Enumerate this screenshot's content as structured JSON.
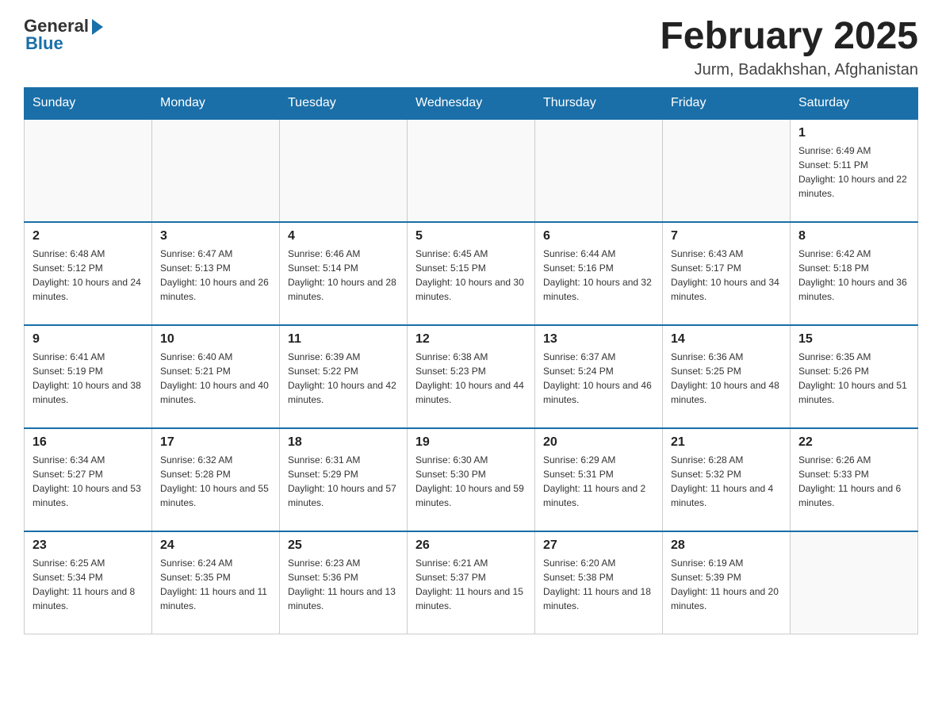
{
  "logo": {
    "general": "General",
    "blue": "Blue"
  },
  "title": "February 2025",
  "location": "Jurm, Badakhshan, Afghanistan",
  "weekdays": [
    "Sunday",
    "Monday",
    "Tuesday",
    "Wednesday",
    "Thursday",
    "Friday",
    "Saturday"
  ],
  "weeks": [
    [
      {
        "day": "",
        "sunrise": "",
        "sunset": "",
        "daylight": ""
      },
      {
        "day": "",
        "sunrise": "",
        "sunset": "",
        "daylight": ""
      },
      {
        "day": "",
        "sunrise": "",
        "sunset": "",
        "daylight": ""
      },
      {
        "day": "",
        "sunrise": "",
        "sunset": "",
        "daylight": ""
      },
      {
        "day": "",
        "sunrise": "",
        "sunset": "",
        "daylight": ""
      },
      {
        "day": "",
        "sunrise": "",
        "sunset": "",
        "daylight": ""
      },
      {
        "day": "1",
        "sunrise": "Sunrise: 6:49 AM",
        "sunset": "Sunset: 5:11 PM",
        "daylight": "Daylight: 10 hours and 22 minutes."
      }
    ],
    [
      {
        "day": "2",
        "sunrise": "Sunrise: 6:48 AM",
        "sunset": "Sunset: 5:12 PM",
        "daylight": "Daylight: 10 hours and 24 minutes."
      },
      {
        "day": "3",
        "sunrise": "Sunrise: 6:47 AM",
        "sunset": "Sunset: 5:13 PM",
        "daylight": "Daylight: 10 hours and 26 minutes."
      },
      {
        "day": "4",
        "sunrise": "Sunrise: 6:46 AM",
        "sunset": "Sunset: 5:14 PM",
        "daylight": "Daylight: 10 hours and 28 minutes."
      },
      {
        "day": "5",
        "sunrise": "Sunrise: 6:45 AM",
        "sunset": "Sunset: 5:15 PM",
        "daylight": "Daylight: 10 hours and 30 minutes."
      },
      {
        "day": "6",
        "sunrise": "Sunrise: 6:44 AM",
        "sunset": "Sunset: 5:16 PM",
        "daylight": "Daylight: 10 hours and 32 minutes."
      },
      {
        "day": "7",
        "sunrise": "Sunrise: 6:43 AM",
        "sunset": "Sunset: 5:17 PM",
        "daylight": "Daylight: 10 hours and 34 minutes."
      },
      {
        "day": "8",
        "sunrise": "Sunrise: 6:42 AM",
        "sunset": "Sunset: 5:18 PM",
        "daylight": "Daylight: 10 hours and 36 minutes."
      }
    ],
    [
      {
        "day": "9",
        "sunrise": "Sunrise: 6:41 AM",
        "sunset": "Sunset: 5:19 PM",
        "daylight": "Daylight: 10 hours and 38 minutes."
      },
      {
        "day": "10",
        "sunrise": "Sunrise: 6:40 AM",
        "sunset": "Sunset: 5:21 PM",
        "daylight": "Daylight: 10 hours and 40 minutes."
      },
      {
        "day": "11",
        "sunrise": "Sunrise: 6:39 AM",
        "sunset": "Sunset: 5:22 PM",
        "daylight": "Daylight: 10 hours and 42 minutes."
      },
      {
        "day": "12",
        "sunrise": "Sunrise: 6:38 AM",
        "sunset": "Sunset: 5:23 PM",
        "daylight": "Daylight: 10 hours and 44 minutes."
      },
      {
        "day": "13",
        "sunrise": "Sunrise: 6:37 AM",
        "sunset": "Sunset: 5:24 PM",
        "daylight": "Daylight: 10 hours and 46 minutes."
      },
      {
        "day": "14",
        "sunrise": "Sunrise: 6:36 AM",
        "sunset": "Sunset: 5:25 PM",
        "daylight": "Daylight: 10 hours and 48 minutes."
      },
      {
        "day": "15",
        "sunrise": "Sunrise: 6:35 AM",
        "sunset": "Sunset: 5:26 PM",
        "daylight": "Daylight: 10 hours and 51 minutes."
      }
    ],
    [
      {
        "day": "16",
        "sunrise": "Sunrise: 6:34 AM",
        "sunset": "Sunset: 5:27 PM",
        "daylight": "Daylight: 10 hours and 53 minutes."
      },
      {
        "day": "17",
        "sunrise": "Sunrise: 6:32 AM",
        "sunset": "Sunset: 5:28 PM",
        "daylight": "Daylight: 10 hours and 55 minutes."
      },
      {
        "day": "18",
        "sunrise": "Sunrise: 6:31 AM",
        "sunset": "Sunset: 5:29 PM",
        "daylight": "Daylight: 10 hours and 57 minutes."
      },
      {
        "day": "19",
        "sunrise": "Sunrise: 6:30 AM",
        "sunset": "Sunset: 5:30 PM",
        "daylight": "Daylight: 10 hours and 59 minutes."
      },
      {
        "day": "20",
        "sunrise": "Sunrise: 6:29 AM",
        "sunset": "Sunset: 5:31 PM",
        "daylight": "Daylight: 11 hours and 2 minutes."
      },
      {
        "day": "21",
        "sunrise": "Sunrise: 6:28 AM",
        "sunset": "Sunset: 5:32 PM",
        "daylight": "Daylight: 11 hours and 4 minutes."
      },
      {
        "day": "22",
        "sunrise": "Sunrise: 6:26 AM",
        "sunset": "Sunset: 5:33 PM",
        "daylight": "Daylight: 11 hours and 6 minutes."
      }
    ],
    [
      {
        "day": "23",
        "sunrise": "Sunrise: 6:25 AM",
        "sunset": "Sunset: 5:34 PM",
        "daylight": "Daylight: 11 hours and 8 minutes."
      },
      {
        "day": "24",
        "sunrise": "Sunrise: 6:24 AM",
        "sunset": "Sunset: 5:35 PM",
        "daylight": "Daylight: 11 hours and 11 minutes."
      },
      {
        "day": "25",
        "sunrise": "Sunrise: 6:23 AM",
        "sunset": "Sunset: 5:36 PM",
        "daylight": "Daylight: 11 hours and 13 minutes."
      },
      {
        "day": "26",
        "sunrise": "Sunrise: 6:21 AM",
        "sunset": "Sunset: 5:37 PM",
        "daylight": "Daylight: 11 hours and 15 minutes."
      },
      {
        "day": "27",
        "sunrise": "Sunrise: 6:20 AM",
        "sunset": "Sunset: 5:38 PM",
        "daylight": "Daylight: 11 hours and 18 minutes."
      },
      {
        "day": "28",
        "sunrise": "Sunrise: 6:19 AM",
        "sunset": "Sunset: 5:39 PM",
        "daylight": "Daylight: 11 hours and 20 minutes."
      },
      {
        "day": "",
        "sunrise": "",
        "sunset": "",
        "daylight": ""
      }
    ]
  ]
}
